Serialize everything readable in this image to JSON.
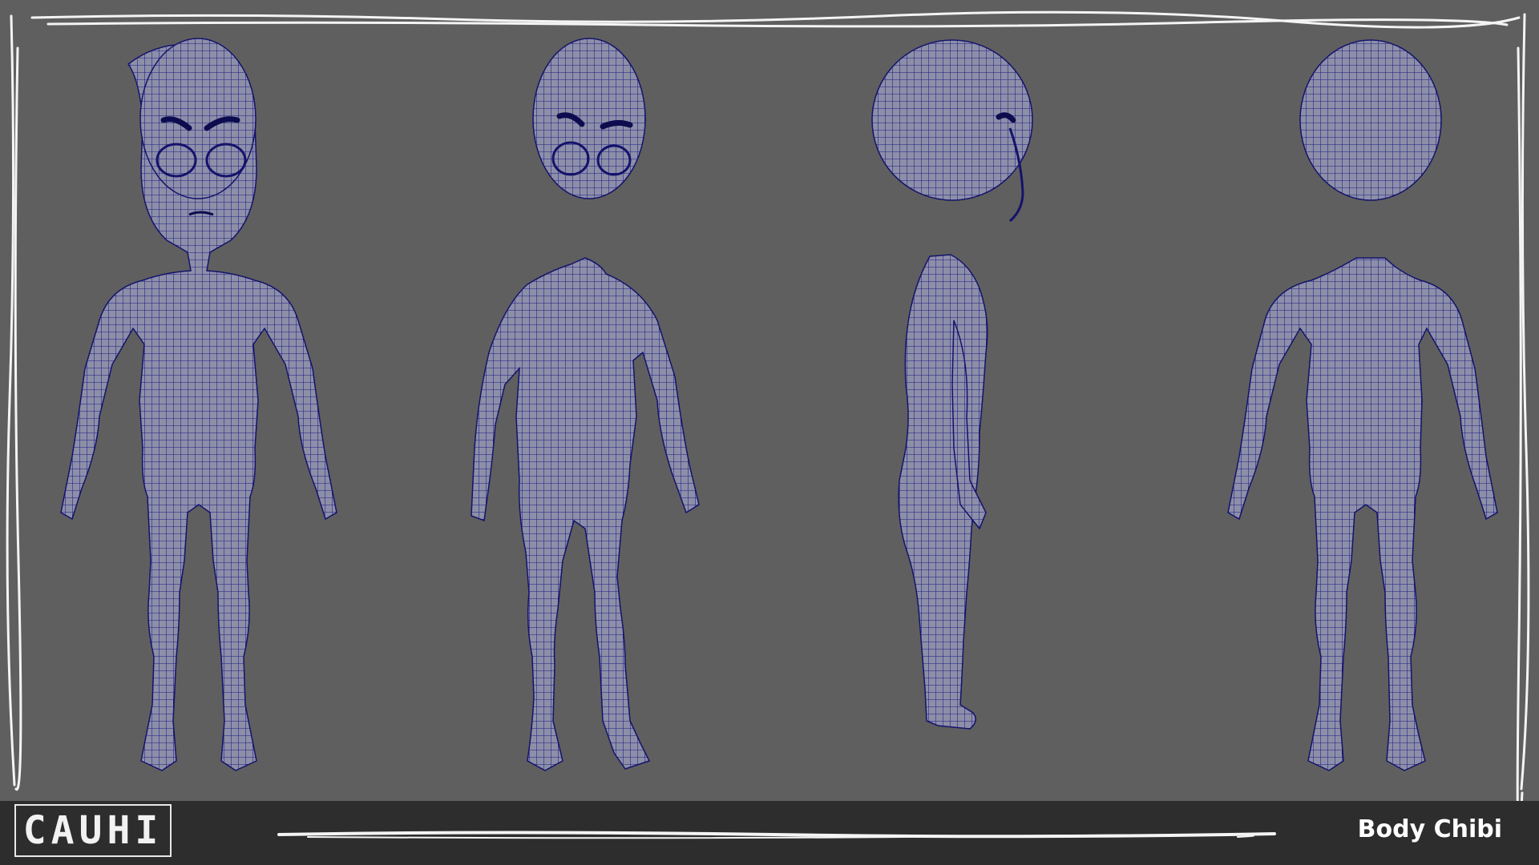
{
  "logo": {
    "text": "CAUHI"
  },
  "footer": {
    "title": "Body Chibi"
  },
  "views": [
    {
      "name": "front"
    },
    {
      "name": "three-quarter"
    },
    {
      "name": "side"
    },
    {
      "name": "back"
    }
  ],
  "colors": {
    "background": "#5f5f5f",
    "mesh_fill": "#8d8fa8",
    "mesh_wire": "#1c1b86",
    "frame_stroke": "#f4f4f4",
    "footer_bg": "#2d2d2d",
    "footer_text": "#ffffff"
  }
}
